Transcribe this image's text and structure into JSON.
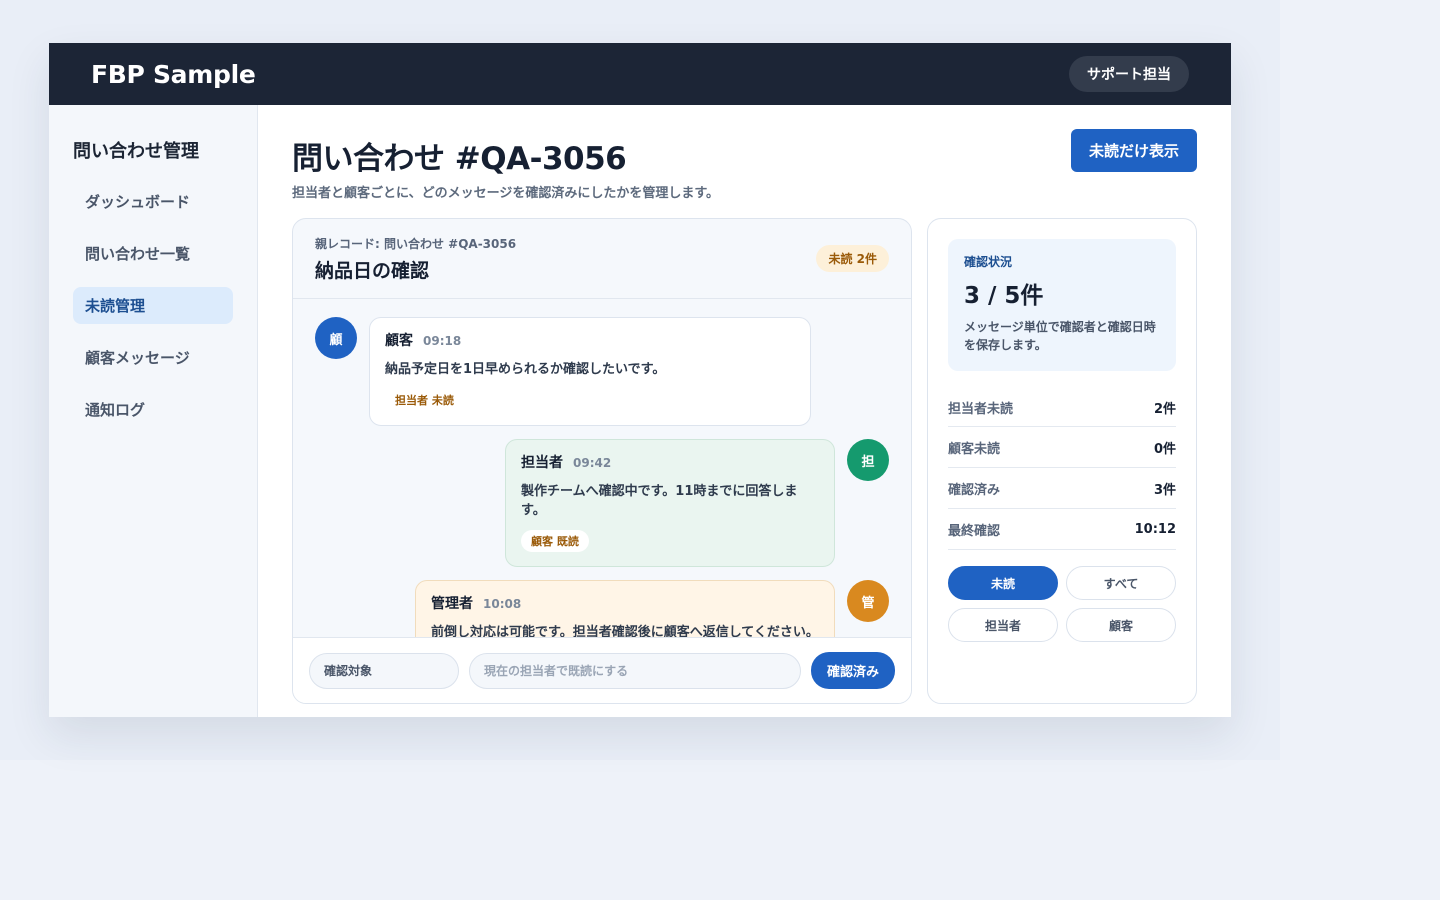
{
  "app": {
    "brand": "FBP Sample",
    "role": "サポート担当"
  },
  "sidebar": {
    "title": "問い合わせ管理",
    "items": [
      {
        "label": "ダッシュボード",
        "active": false
      },
      {
        "label": "問い合わせ一覧",
        "active": false
      },
      {
        "label": "未読管理",
        "active": true
      },
      {
        "label": "顧客メッセージ",
        "active": false
      },
      {
        "label": "通知ログ",
        "active": false
      }
    ]
  },
  "header": {
    "title": "問い合わせ #QA-3056",
    "subtitle": "担当者と顧客ごとに、どのメッセージを確認済みにしたかを管理します。",
    "unread_only_button": "未読だけ表示"
  },
  "thread": {
    "parent_record": "親レコード: 問い合わせ #QA-3056",
    "title": "納品日の確認",
    "unread_badge": "未読 2件",
    "messages": [
      {
        "avatar": "顧",
        "sender": "顧客",
        "time": "09:18",
        "text": "納品予定日を1日早められるか確認したいです。",
        "receipt": "担当者 未読"
      },
      {
        "avatar": "担",
        "sender": "担当者",
        "time": "09:42",
        "text": "製作チームへ確認中です。11時までに回答します。",
        "receipt": "顧客 既読"
      },
      {
        "avatar": "管",
        "sender": "管理者",
        "time": "10:08",
        "text": "前倒し対応は可能です。担当者確認後に顧客へ返信してください。"
      }
    ],
    "composer": {
      "target": "確認対象",
      "placeholder": "現在の担当者で既読にする",
      "confirm_button": "確認済み"
    }
  },
  "status": {
    "label": "確認状況",
    "count": "3 / 5件",
    "description": "メッセージ単位で確認者と確認日時を保存します。",
    "rows": [
      {
        "key": "担当者未読",
        "value": "2件"
      },
      {
        "key": "顧客未読",
        "value": "0件"
      },
      {
        "key": "確認済み",
        "value": "3件"
      },
      {
        "key": "最終確認",
        "value": "10:12"
      }
    ],
    "filters": [
      {
        "label": "未読",
        "active": true
      },
      {
        "label": "すべて",
        "active": false
      },
      {
        "label": "担当者",
        "active": false
      },
      {
        "label": "顧客",
        "active": false
      }
    ]
  },
  "colors": {
    "primary": "#1f62c3",
    "topbar": "#1c2536",
    "avatar_customer": "#1f62c3",
    "avatar_staff": "#159a6e",
    "avatar_admin": "#d9891f"
  }
}
